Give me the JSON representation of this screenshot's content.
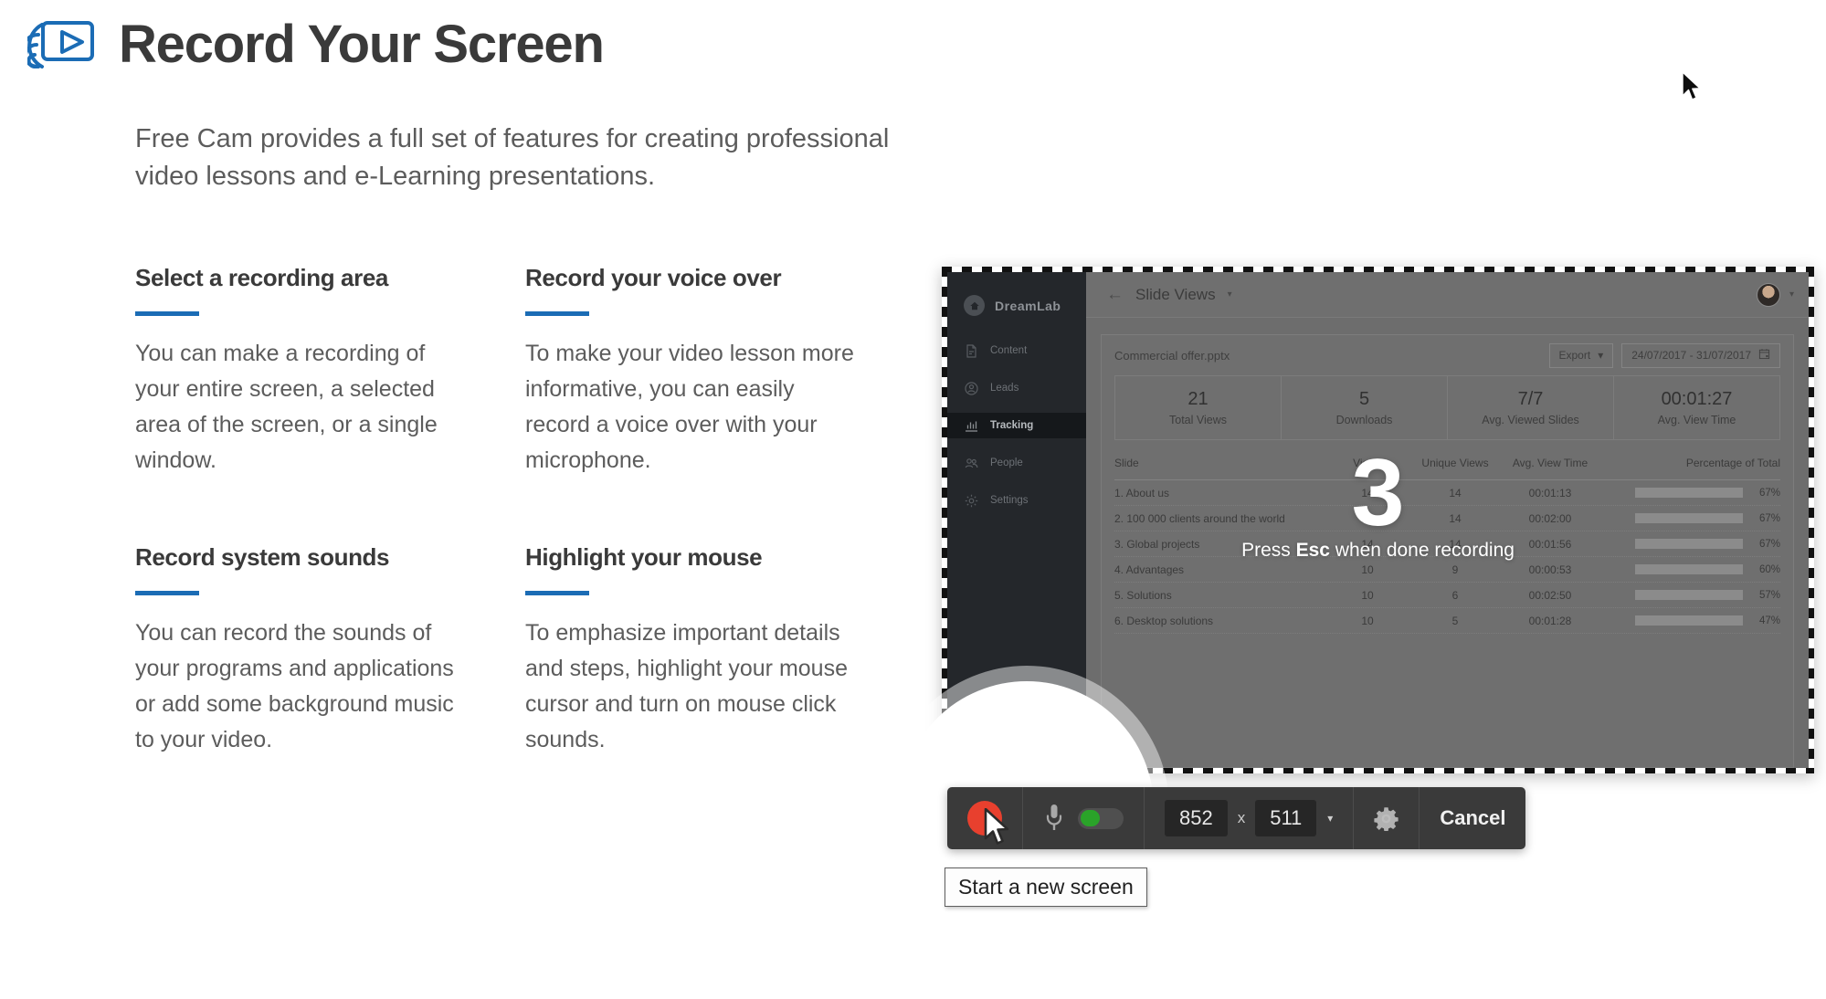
{
  "header": {
    "title": "Record Your Screen",
    "icon": "screen-record-icon"
  },
  "intro": "Free Cam provides a full set of features for creating professional video lessons and e-Learning presentations.",
  "features": [
    {
      "title": "Select a recording area",
      "body": "You can make a recording of your entire screen, a selected area of the screen, or a single window."
    },
    {
      "title": "Record your voice over",
      "body": "To make your video lesson more informative, you can easily record a voice over with your microphone."
    },
    {
      "title": "Record system sounds",
      "body": "You can record the sounds of your programs and applications or add some background music to your video."
    },
    {
      "title": "Highlight your mouse",
      "body": "To emphasize important details and steps, highlight your mouse cursor and turn on mouse click sounds."
    }
  ],
  "accent_color": "#1b6cb5",
  "capture": {
    "sidebar": {
      "logo": "DreamLab",
      "items": [
        {
          "label": "Content",
          "icon": "document-icon",
          "active": false
        },
        {
          "label": "Leads",
          "icon": "person-circle-icon",
          "active": false
        },
        {
          "label": "Tracking",
          "icon": "bar-chart-icon",
          "active": true
        },
        {
          "label": "People",
          "icon": "people-icon",
          "active": false
        },
        {
          "label": "Settings",
          "icon": "gear-icon",
          "active": false
        }
      ]
    },
    "topbar": {
      "back_label": "←",
      "title": "Slide Views",
      "caret": "▾",
      "avatar_caret": "▾"
    },
    "card_head": {
      "file_name": "Commercial offer.pptx",
      "export_label": "Export",
      "export_caret": "▾",
      "date_range": "24/07/2017 - 31/07/2017",
      "calendar_icon": "calendar-icon"
    },
    "stats": [
      {
        "value": "21",
        "label": "Total Views"
      },
      {
        "value": "5",
        "label": "Downloads"
      },
      {
        "value": "7/7",
        "label": "Avg. Viewed Slides"
      },
      {
        "value": "00:01:27",
        "label": "Avg. View Time"
      }
    ],
    "table": {
      "columns": [
        "Slide",
        "Views",
        "Unique Views",
        "Avg. View Time",
        "Percentage of Total"
      ],
      "rows": [
        {
          "slide": "1. About us",
          "views": "14",
          "unique": "14",
          "time": "00:01:13",
          "pct": "67%",
          "pct_value": 67
        },
        {
          "slide": "2. 100 000 clients around the world",
          "views": "14",
          "unique": "14",
          "time": "00:02:00",
          "pct": "67%",
          "pct_value": 67
        },
        {
          "slide": "3. Global projects",
          "views": "14",
          "unique": "14",
          "time": "00:01:56",
          "pct": "67%",
          "pct_value": 67
        },
        {
          "slide": "4. Advantages",
          "views": "10",
          "unique": "9",
          "time": "00:00:53",
          "pct": "60%",
          "pct_value": 60
        },
        {
          "slide": "5. Solutions",
          "views": "10",
          "unique": "6",
          "time": "00:02:50",
          "pct": "57%",
          "pct_value": 57
        },
        {
          "slide": "6. Desktop solutions",
          "views": "10",
          "unique": "5",
          "time": "00:01:28",
          "pct": "47%",
          "pct_value": 47
        }
      ]
    },
    "countdown": {
      "number": "3",
      "hint_before": "Press ",
      "hint_key": "Esc",
      "hint_after": " when done recording"
    },
    "bar_color": "#2f4566"
  },
  "toolbar": {
    "record_icon": "record-circle-icon",
    "mic_icon": "microphone-icon",
    "mic_toggle_state": "on",
    "mic_toggle_color": "#2aa329",
    "width_value": "852",
    "dimension_separator": "x",
    "height_value": "511",
    "size_caret": "▾",
    "settings_icon": "gear-icon",
    "cancel_label": "Cancel"
  },
  "tooltip": "Start a new screen"
}
